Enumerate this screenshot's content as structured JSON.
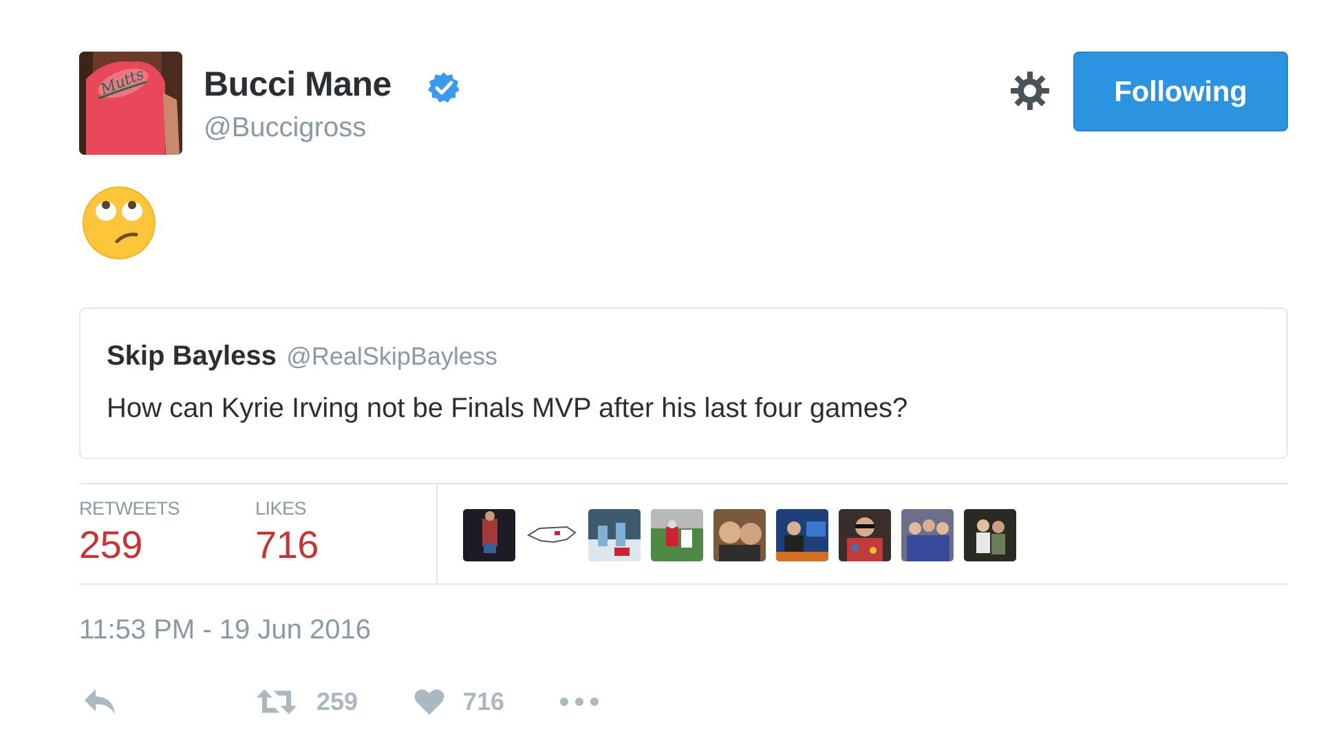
{
  "tweet": {
    "author": {
      "name": "Bucci Mane",
      "handle": "@Buccigross",
      "verified": true
    },
    "follow_button_label": "Following",
    "body_emoji": "face-with-rolling-eyes",
    "quoted": {
      "name": "Skip Bayless",
      "handle": "@RealSkipBayless",
      "text": "How can Kyrie Irving not be Finals MVP after his last four games?"
    },
    "stats": {
      "retweets_label": "RETWEETS",
      "retweets_count": "259",
      "likes_label": "LIKES",
      "likes_count": "716"
    },
    "timestamp": "11:53 PM - 19 Jun 2016",
    "actions": {
      "retweet_count": "259",
      "like_count": "716"
    }
  },
  "colors": {
    "follow_button": "#2b93e0",
    "stat_value": "#c93232",
    "muted_text": "#8899a6",
    "border": "#e1e8ed",
    "verified_badge": "#3a9af2"
  }
}
